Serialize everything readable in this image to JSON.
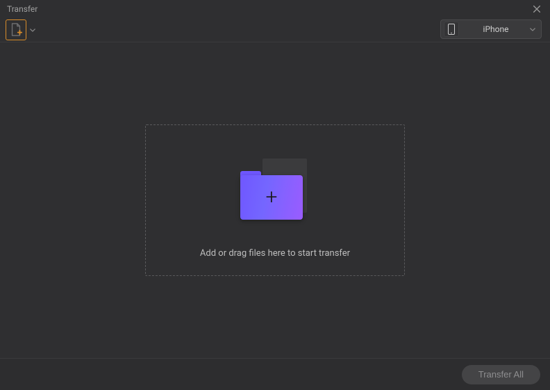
{
  "titlebar": {
    "title": "Transfer"
  },
  "device": {
    "selected": "iPhone"
  },
  "dropzone": {
    "hint": "Add or drag files here to start transfer"
  },
  "footer": {
    "transfer_all": "Transfer All"
  }
}
